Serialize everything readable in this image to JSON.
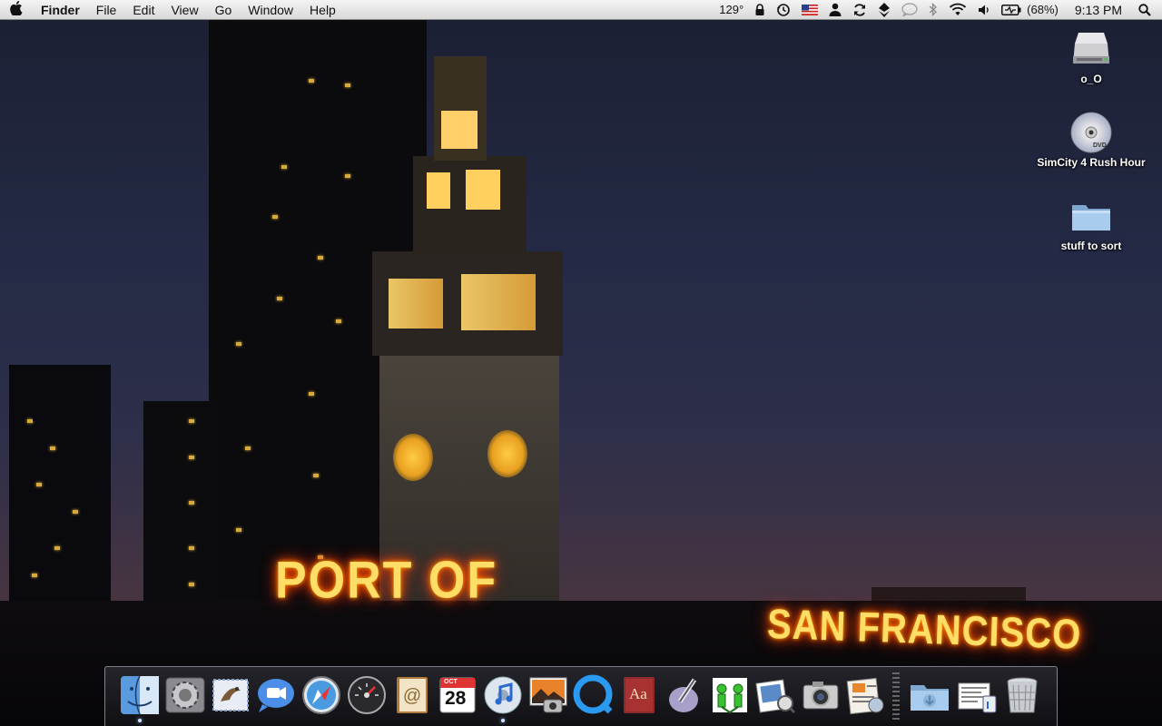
{
  "menubar": {
    "apple": "",
    "app_name": "Finder",
    "menus": [
      "File",
      "Edit",
      "View",
      "Go",
      "Window",
      "Help"
    ],
    "status": {
      "temperature": "129°",
      "battery": "(68%)",
      "time": "9:13 PM"
    },
    "status_icons": [
      "lock-icon",
      "time-machine-icon",
      "us-flag-icon",
      "user-icon",
      "sync-icon",
      "vpn-icon",
      "chat-icon",
      "bluetooth-icon",
      "wifi-icon",
      "volume-icon",
      "battery-icon",
      "spotlight-icon"
    ]
  },
  "wallpaper": {
    "sign_left": "PORT OF",
    "sign_right": "SAN FRANCISCO"
  },
  "desktop": {
    "icons": [
      {
        "label": "o_O",
        "icon": "hard-drive-icon"
      },
      {
        "label": "SimCity 4 Rush Hour",
        "icon": "dvd-icon"
      },
      {
        "label": "stuff to sort",
        "icon": "folder-icon"
      }
    ]
  },
  "dock": {
    "items": [
      "finder-icon",
      "system-preferences-icon",
      "mail-icon",
      "ichat-icon",
      "safari-icon",
      "dashboard-icon",
      "address-book-icon",
      "ical-icon",
      "itunes-icon",
      "iphoto-icon",
      "quicktime-icon",
      "dictionary-icon",
      "script-editor-icon",
      "family-tree-icon",
      "preview-icon",
      "image-capture-icon",
      "pages-icon",
      "downloads-folder-icon",
      "documents-stack-icon",
      "trash-icon"
    ],
    "ical_month": "OCT",
    "ical_day": "28",
    "dictionary_label": "Aa",
    "colors": {
      "running_indicator": "#cfe6ff"
    }
  }
}
